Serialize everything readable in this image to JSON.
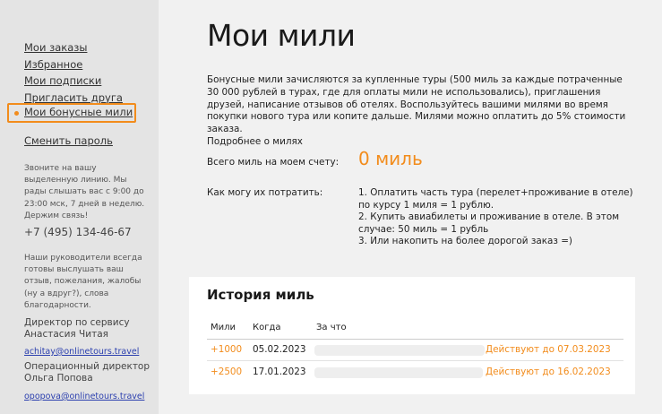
{
  "sidebar": {
    "nav": [
      {
        "label": "Мои заказы"
      },
      {
        "label": "Избранное"
      },
      {
        "label": "Мои подписки"
      },
      {
        "label": "Пригласить друга"
      },
      {
        "label": "Мои бонусные мили",
        "active": true
      },
      {
        "label": "Сменить пароль"
      }
    ],
    "contact_text": "Звоните на вашу выделенную линию. Мы рады слышать вас с 9:00 до 23:00 мск, 7 дней в неделю. Держим связь!",
    "phone": "+7 (495) 134-46-67",
    "managers_text": "Наши руководители всегда готовы выслушать ваш отзыв, пожелания, жалобы (ну а вдруг?), слова благодарности.",
    "managers": [
      {
        "title": "Директор по сервису Анастасия Читая",
        "email": "achitay@onlinetours.travel"
      },
      {
        "title": "Операционный директор Ольга Попова",
        "email": "opopova@onlinetours.travel"
      }
    ],
    "accent": "#f28c1c"
  },
  "main": {
    "title": "Мои мили",
    "intro": "Бонусные мили зачисляются за купленные туры (500 миль за каждые потраченные 30 000 рублей в турах, где для оплаты мили не использовались), приглашения друзей, написание отзывов об отелях. Воспользуйтесь вашими милями во время покупки нового тура или копите дальше. Милями можно оплатить до 5% стоимости заказа.",
    "more_link": "Подробнее о милях",
    "total_label": "Всего миль на моем счету:",
    "total_value": "0 миль",
    "howto_label": "Как могу их потратить:",
    "howto": [
      "1. Оплатить часть тура (перелет+проживание в отеле) по курсу 1 миля = 1 рублю.",
      "2. Купить авиабилеты и проживание в отеле. В этом случае: 50 миль = 1 рубль",
      "3. Или накопить на более дорогой заказ =)"
    ]
  },
  "history": {
    "title": "История миль",
    "columns": [
      "Мили",
      "Когда",
      "За что"
    ],
    "rows": [
      {
        "miles": "+1000",
        "date": "05.02.2023",
        "valid": "Действуют до 07.03.2023"
      },
      {
        "miles": "+2500",
        "date": "17.01.2023",
        "valid": "Действуют до 16.02.2023"
      }
    ]
  }
}
